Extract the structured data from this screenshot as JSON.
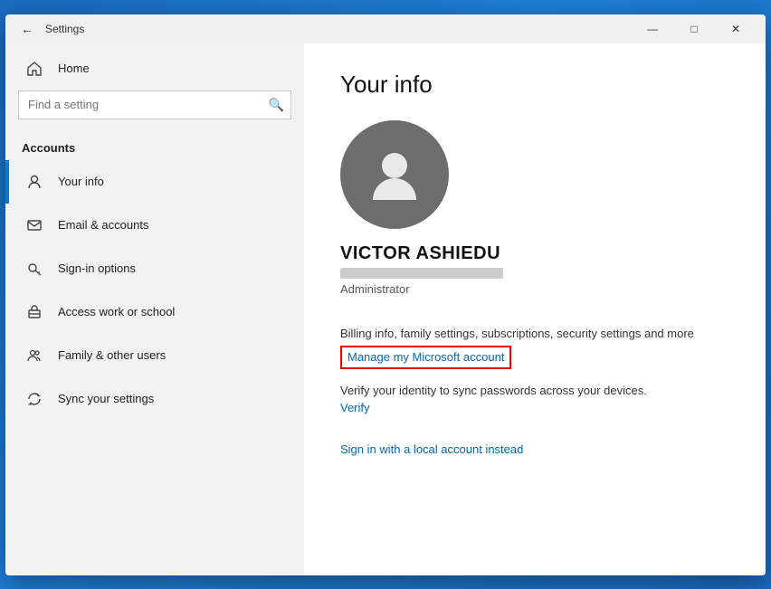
{
  "window": {
    "title": "Settings",
    "back_icon": "←",
    "minimize_icon": "—",
    "maximize_icon": "□",
    "close_icon": "✕"
  },
  "sidebar": {
    "section_label": "Accounts",
    "search_placeholder": "Find a setting",
    "search_icon": "🔍",
    "nav_items": [
      {
        "id": "your-info",
        "label": "Your info",
        "icon": "person",
        "active": true
      },
      {
        "id": "email-accounts",
        "label": "Email & accounts",
        "icon": "email",
        "active": false
      },
      {
        "id": "sign-in-options",
        "label": "Sign-in options",
        "icon": "key",
        "active": false
      },
      {
        "id": "access-work",
        "label": "Access work or school",
        "icon": "briefcase",
        "active": false
      },
      {
        "id": "family-users",
        "label": "Family & other users",
        "icon": "group",
        "active": false
      },
      {
        "id": "sync-settings",
        "label": "Sync your settings",
        "icon": "sync",
        "active": false
      }
    ]
  },
  "main": {
    "page_title": "Your info",
    "user_name": "VICTOR ASHIEDU",
    "user_role": "Administrator",
    "billing_text": "Billing info, family settings, subscriptions, security settings and more",
    "manage_link": "Manage my Microsoft account",
    "verify_text": "Verify your identity to sync passwords across your devices.",
    "verify_link": "Verify",
    "local_account_link": "Sign in with a local account instead"
  }
}
